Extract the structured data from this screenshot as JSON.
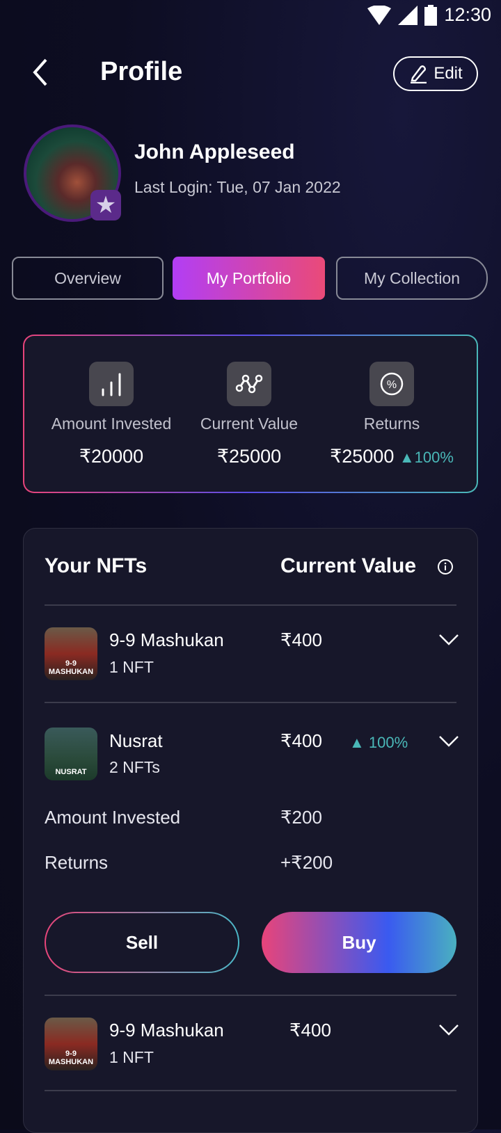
{
  "status_bar": {
    "time": "12:30",
    "icons": [
      "wifi-icon",
      "signal-icon",
      "battery-icon"
    ]
  },
  "header": {
    "title": "Profile",
    "back_icon": "chevron-left-icon",
    "edit_label": "Edit",
    "edit_icon": "pencil-icon"
  },
  "profile": {
    "name": "John Appleseed",
    "last_login": "Last Login: Tue, 07 Jan 2022",
    "badge_icon": "star-icon"
  },
  "tabs": [
    {
      "label": "Overview",
      "active": false
    },
    {
      "label": "My Portfolio",
      "active": true
    },
    {
      "label": "My Collection",
      "active": false
    }
  ],
  "stats": [
    {
      "icon": "bar-chart-icon",
      "label": "Amount Invested",
      "value": "₹20000"
    },
    {
      "icon": "line-chart-icon",
      "label": "Current Value",
      "value": "₹25000"
    },
    {
      "icon": "percent-icon",
      "label": "Returns",
      "value": "₹25000",
      "change": "▲100%"
    }
  ],
  "nfts": {
    "title": "Your NFTs",
    "value_header": "Current Value",
    "info_icon": "info-icon",
    "items": [
      {
        "name": "9-9 Mashukan",
        "count": "1 NFT",
        "value": "₹400",
        "thumb_text": "9-9 MASHUKAN"
      },
      {
        "name": "Nusrat",
        "count": "2 NFTs",
        "value": "₹400",
        "change": "▲ 100%",
        "thumb_text": "NUSRAT",
        "expanded": true,
        "details": [
          {
            "label": "Amount Invested",
            "value": "₹200"
          },
          {
            "label": "Returns",
            "value": "+₹200"
          }
        ],
        "sell_label": "Sell",
        "buy_label": "Buy"
      },
      {
        "name": "9-9 Mashukan",
        "count": "1 NFT",
        "value": "₹400",
        "thumb_text": "9-9 MASHUKAN"
      }
    ]
  },
  "colors": {
    "accent_up": "#4ab8b8",
    "gradient_pink": "#e8447a",
    "gradient_purple": "#b23ef5",
    "gradient_blue": "#3a5af0"
  }
}
